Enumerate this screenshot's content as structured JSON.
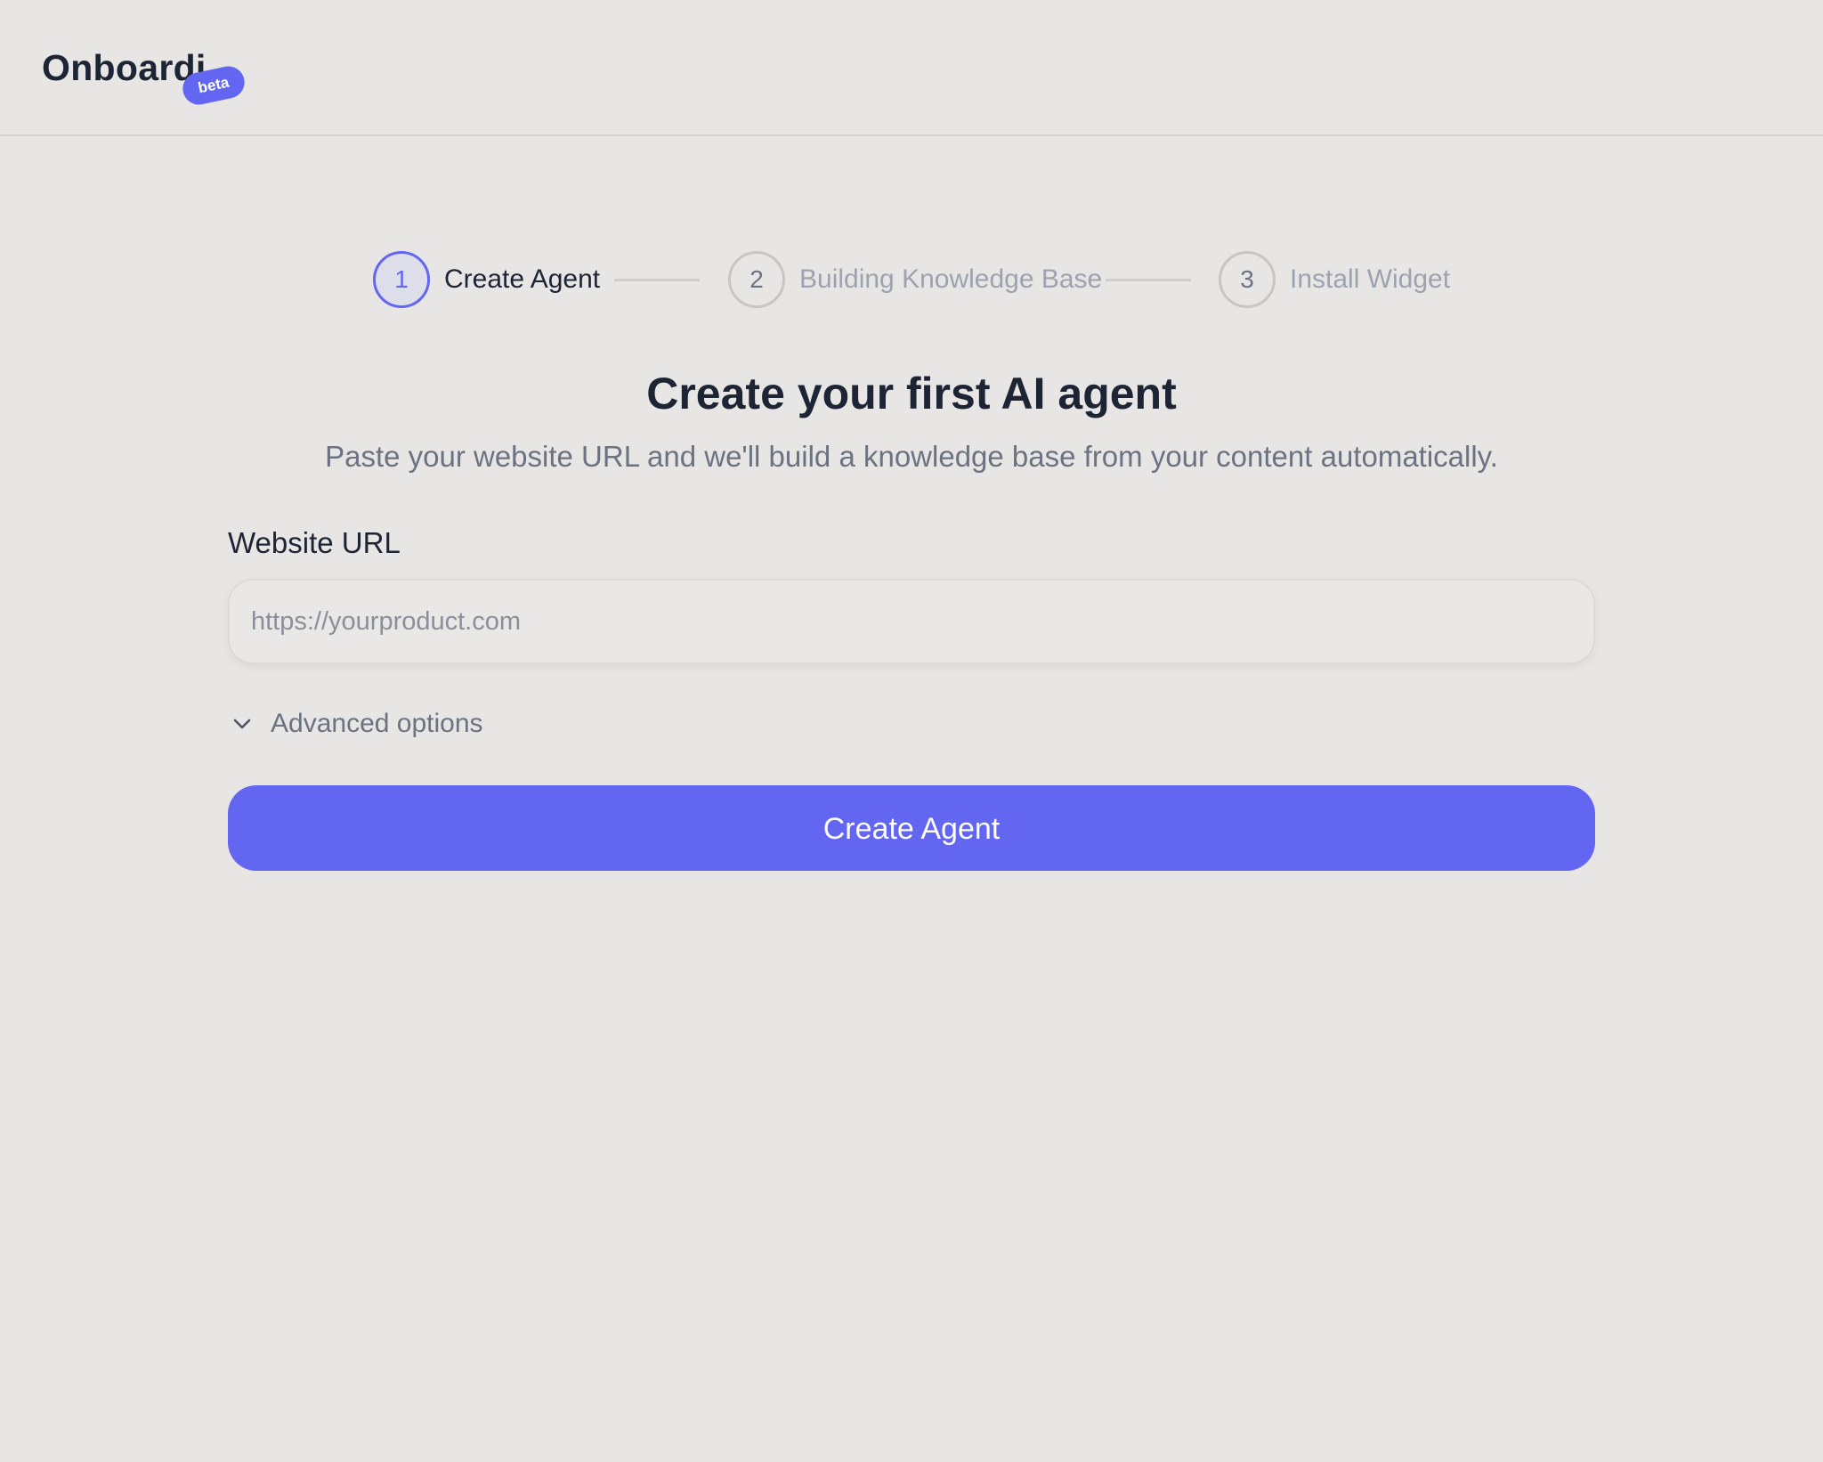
{
  "header": {
    "logo_text": "Onboardi",
    "badge": "beta"
  },
  "stepper": {
    "steps": [
      {
        "number": "1",
        "label": "Create Agent",
        "state": "active"
      },
      {
        "number": "2",
        "label": "Building Knowledge Base",
        "state": "inactive"
      },
      {
        "number": "3",
        "label": "Install Widget",
        "state": "inactive"
      }
    ]
  },
  "main": {
    "title": "Create your first AI agent",
    "subtitle": "Paste your website URL and we'll build a knowledge base from your content automatically.",
    "url_field": {
      "label": "Website URL",
      "value": "",
      "placeholder": "https://yourproduct.com"
    },
    "advanced_options": {
      "label": "Advanced options",
      "icon": "chevron-down-icon",
      "expanded": false
    },
    "submit_label": "Create Agent"
  },
  "colors": {
    "background": "#e7e6e5",
    "accent": "#6366f1",
    "text_primary": "#1d2433",
    "text_muted": "#6b7280",
    "text_inactive": "#9ca3af"
  }
}
